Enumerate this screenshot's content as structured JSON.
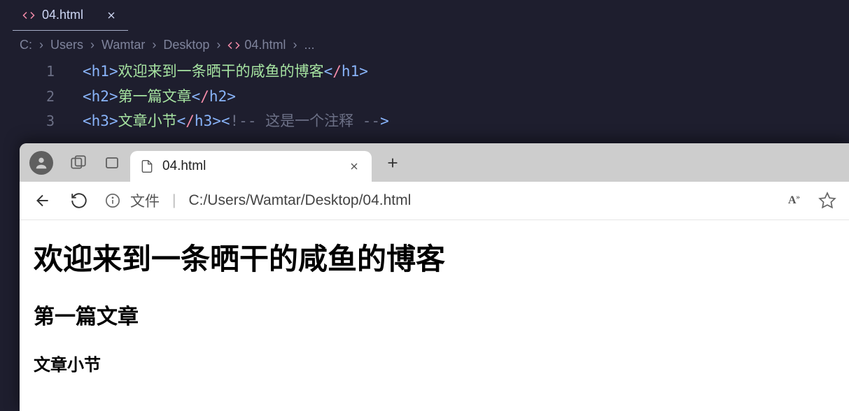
{
  "vscode": {
    "tab": {
      "title": "04.html"
    },
    "breadcrumbs": {
      "parts": [
        "C:",
        "Users",
        "Wamtar",
        "Desktop"
      ],
      "file": "04.html",
      "ellipsis": "..."
    },
    "lines": {
      "l1": {
        "no": "1",
        "tag": "h1",
        "text": "欢迎来到一条晒干的咸鱼的博客"
      },
      "l2": {
        "no": "2",
        "tag": "h2",
        "text": "第一篇文章"
      },
      "l3": {
        "no": "3",
        "tag": "h3",
        "text": "文章小节",
        "comment": " 这是一个注释 "
      }
    }
  },
  "browser": {
    "tab": {
      "title": "04.html"
    },
    "addressbar": {
      "prefix": "文件",
      "url": "C:/Users/Wamtar/Desktop/04.html"
    },
    "page": {
      "h1": "欢迎来到一条晒干的咸鱼的博客",
      "h2": "第一篇文章",
      "h3": "文章小节"
    }
  }
}
